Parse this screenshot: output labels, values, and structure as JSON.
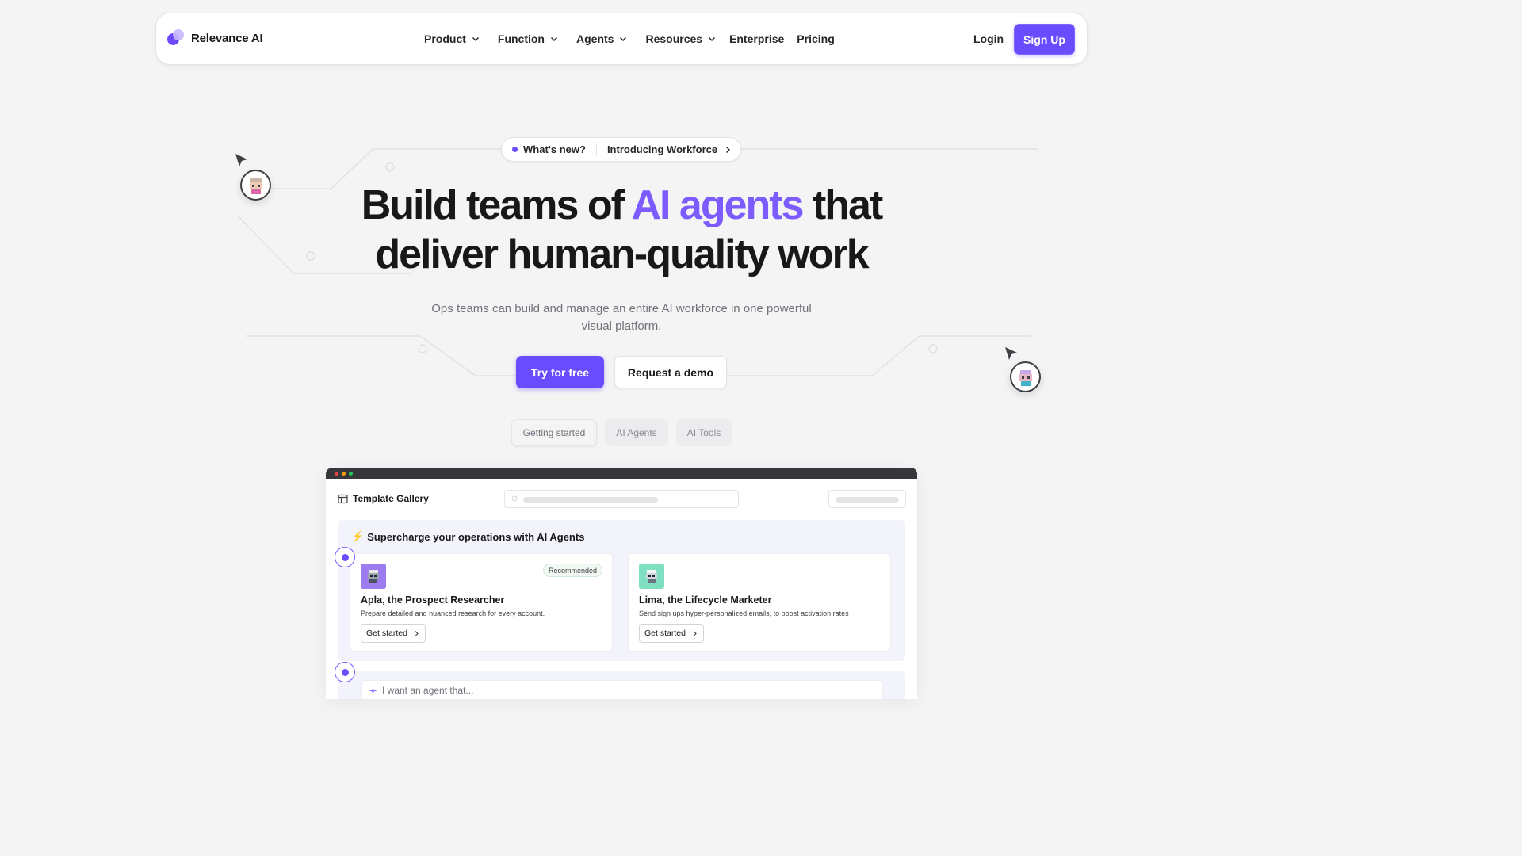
{
  "brand": {
    "name": "Relevance AI",
    "accent": "#6a4cff"
  },
  "nav": {
    "menu": [
      {
        "label": "Product",
        "dropdown": true
      },
      {
        "label": "Function",
        "dropdown": true
      },
      {
        "label": "Agents",
        "dropdown": true
      },
      {
        "label": "Resources",
        "dropdown": true
      },
      {
        "label": "Enterprise",
        "dropdown": false
      },
      {
        "label": "Pricing",
        "dropdown": false
      }
    ],
    "login": "Login",
    "signup": "Sign Up"
  },
  "announcement": {
    "tag": "What's new?",
    "text": "Introducing Workforce"
  },
  "hero": {
    "title_prefix": "Build teams of ",
    "title_accent": "AI agents",
    "title_suffix": " that deliver human-quality work",
    "subtitle": "Ops teams can build and manage an entire AI workforce in one powerful visual platform.",
    "primary_cta": "Try for free",
    "secondary_cta": "Request a demo"
  },
  "tabs": [
    "Getting started",
    "AI Agents",
    "AI Tools"
  ],
  "app": {
    "title": "Template Gallery",
    "section_title": "Supercharge your operations with AI Agents",
    "cards": [
      {
        "name": "Apla, the Prospect Researcher",
        "description": "Prepare detailed and nuanced research for every account.",
        "cta": "Get started",
        "badge": "Recommended",
        "icon_color": "#9d7cf0"
      },
      {
        "name": "Lima, the Lifecycle Marketer",
        "description": "Send sign ups hyper-personalized emails, to boost activation rates",
        "cta": "Get started",
        "badge": "",
        "icon_color": "#7ee0c0"
      }
    ],
    "prompt_placeholder": "I want an agent that..."
  }
}
